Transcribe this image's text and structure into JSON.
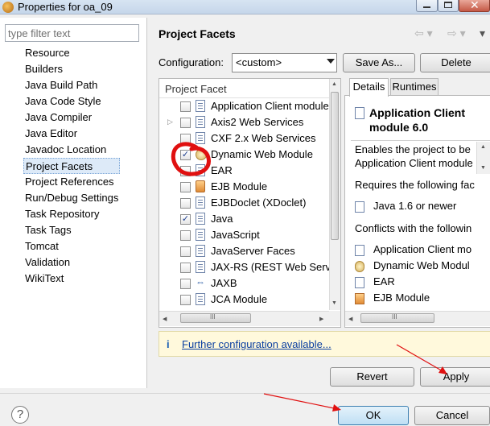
{
  "window": {
    "title": "Properties for oa_09",
    "close_glyph": "✕"
  },
  "sidebar": {
    "filter_placeholder": "type filter text",
    "items": [
      {
        "label": "Resource"
      },
      {
        "label": "Builders"
      },
      {
        "label": "Java Build Path"
      },
      {
        "label": "Java Code Style"
      },
      {
        "label": "Java Compiler"
      },
      {
        "label": "Java Editor"
      },
      {
        "label": "Javadoc Location"
      },
      {
        "label": "Project Facets",
        "selected": true
      },
      {
        "label": "Project References"
      },
      {
        "label": "Run/Debug Settings"
      },
      {
        "label": "Task Repository"
      },
      {
        "label": "Task Tags"
      },
      {
        "label": "Tomcat"
      },
      {
        "label": "Validation"
      },
      {
        "label": "WikiText"
      }
    ]
  },
  "page": {
    "title": "Project Facets",
    "back_glyph": "⇦ ▾",
    "forward_glyph": "⇨ ▾",
    "menu_glyph": "▾"
  },
  "configuration": {
    "label": "Configuration:",
    "value": "<custom>",
    "save_as_label": "Save As...",
    "delete_label": "Delete"
  },
  "facets": {
    "header": "Project Facet",
    "rows": [
      {
        "label": "Application Client module",
        "checked": false,
        "icon": "page-icon",
        "expandable": false
      },
      {
        "label": "Axis2 Web Services",
        "checked": false,
        "icon": "page-icon",
        "expandable": true
      },
      {
        "label": "CXF 2.x Web Services",
        "checked": false,
        "icon": "page-icon",
        "expandable": false
      },
      {
        "label": "Dynamic Web Module",
        "checked": true,
        "icon": "globe-icon",
        "expandable": false
      },
      {
        "label": "EAR",
        "checked": false,
        "icon": "page-icon",
        "expandable": false
      },
      {
        "label": "EJB Module",
        "checked": false,
        "icon": "bean-icon",
        "expandable": false
      },
      {
        "label": "EJBDoclet (XDoclet)",
        "checked": false,
        "icon": "page-icon",
        "expandable": false
      },
      {
        "label": "Java",
        "checked": true,
        "icon": "page-icon",
        "expandable": false
      },
      {
        "label": "JavaScript",
        "checked": false,
        "icon": "page-icon",
        "expandable": false
      },
      {
        "label": "JavaServer Faces",
        "checked": false,
        "icon": "page-icon",
        "expandable": false
      },
      {
        "label": "JAX-RS (REST Web Services)",
        "checked": false,
        "icon": "page-icon",
        "expandable": false
      },
      {
        "label": "JAXB",
        "checked": false,
        "icon": "jaxb-icon",
        "expandable": false
      },
      {
        "label": "JCA Module",
        "checked": false,
        "icon": "page-icon",
        "expandable": false
      }
    ],
    "check_glyph": "✓",
    "expand_glyph": "▷",
    "jaxb_glyph": "⇔"
  },
  "details": {
    "tab_details": "Details",
    "tab_runtimes": "Runtimes",
    "title": "Application Client module 6.0",
    "description_line1": "Enables the project to be",
    "description_line2": "Application Client module",
    "requires_label": "Requires the following fac",
    "requires_item": "Java 1.6 or newer",
    "conflicts_label": "Conflicts with the followin",
    "conflicts": [
      {
        "label": "Application Client mo",
        "icon": "page-icon"
      },
      {
        "label": "Dynamic Web Modul",
        "icon": "globe-icon"
      },
      {
        "label": "EAR",
        "icon": "page-icon"
      },
      {
        "label": "EJB Module",
        "icon": "bean-icon"
      }
    ]
  },
  "scroll_glyphs": {
    "up": "▲",
    "down": "▼",
    "left": "◀",
    "right": "▶",
    "grip": "≡",
    "hgrip": "III"
  },
  "info": {
    "icon": "i",
    "link": "Further configuration available..."
  },
  "actions": {
    "revert_label": "Revert",
    "apply_label": "Apply"
  },
  "footer": {
    "help_glyph": "?",
    "ok_label": "OK",
    "cancel_label": "Cancel"
  },
  "colors": {
    "annotation_red": "#e01010",
    "selection_blue": "#ddeaf8",
    "link_blue": "#0a3ea0",
    "info_bg": "#fff9dc"
  }
}
